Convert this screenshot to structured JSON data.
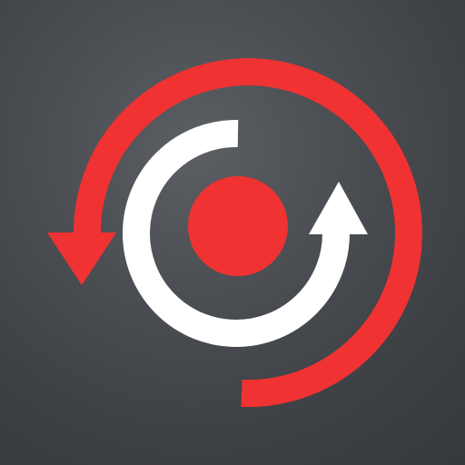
{
  "icon": {
    "name": "sync-record-icon",
    "colors": {
      "background": "#45484d",
      "accent": "#f03232",
      "foreground": "#ffffff"
    },
    "elements": [
      "outer-red-counterclockwise-arrow",
      "inner-white-clockwise-arrow",
      "center-red-dot"
    ]
  }
}
